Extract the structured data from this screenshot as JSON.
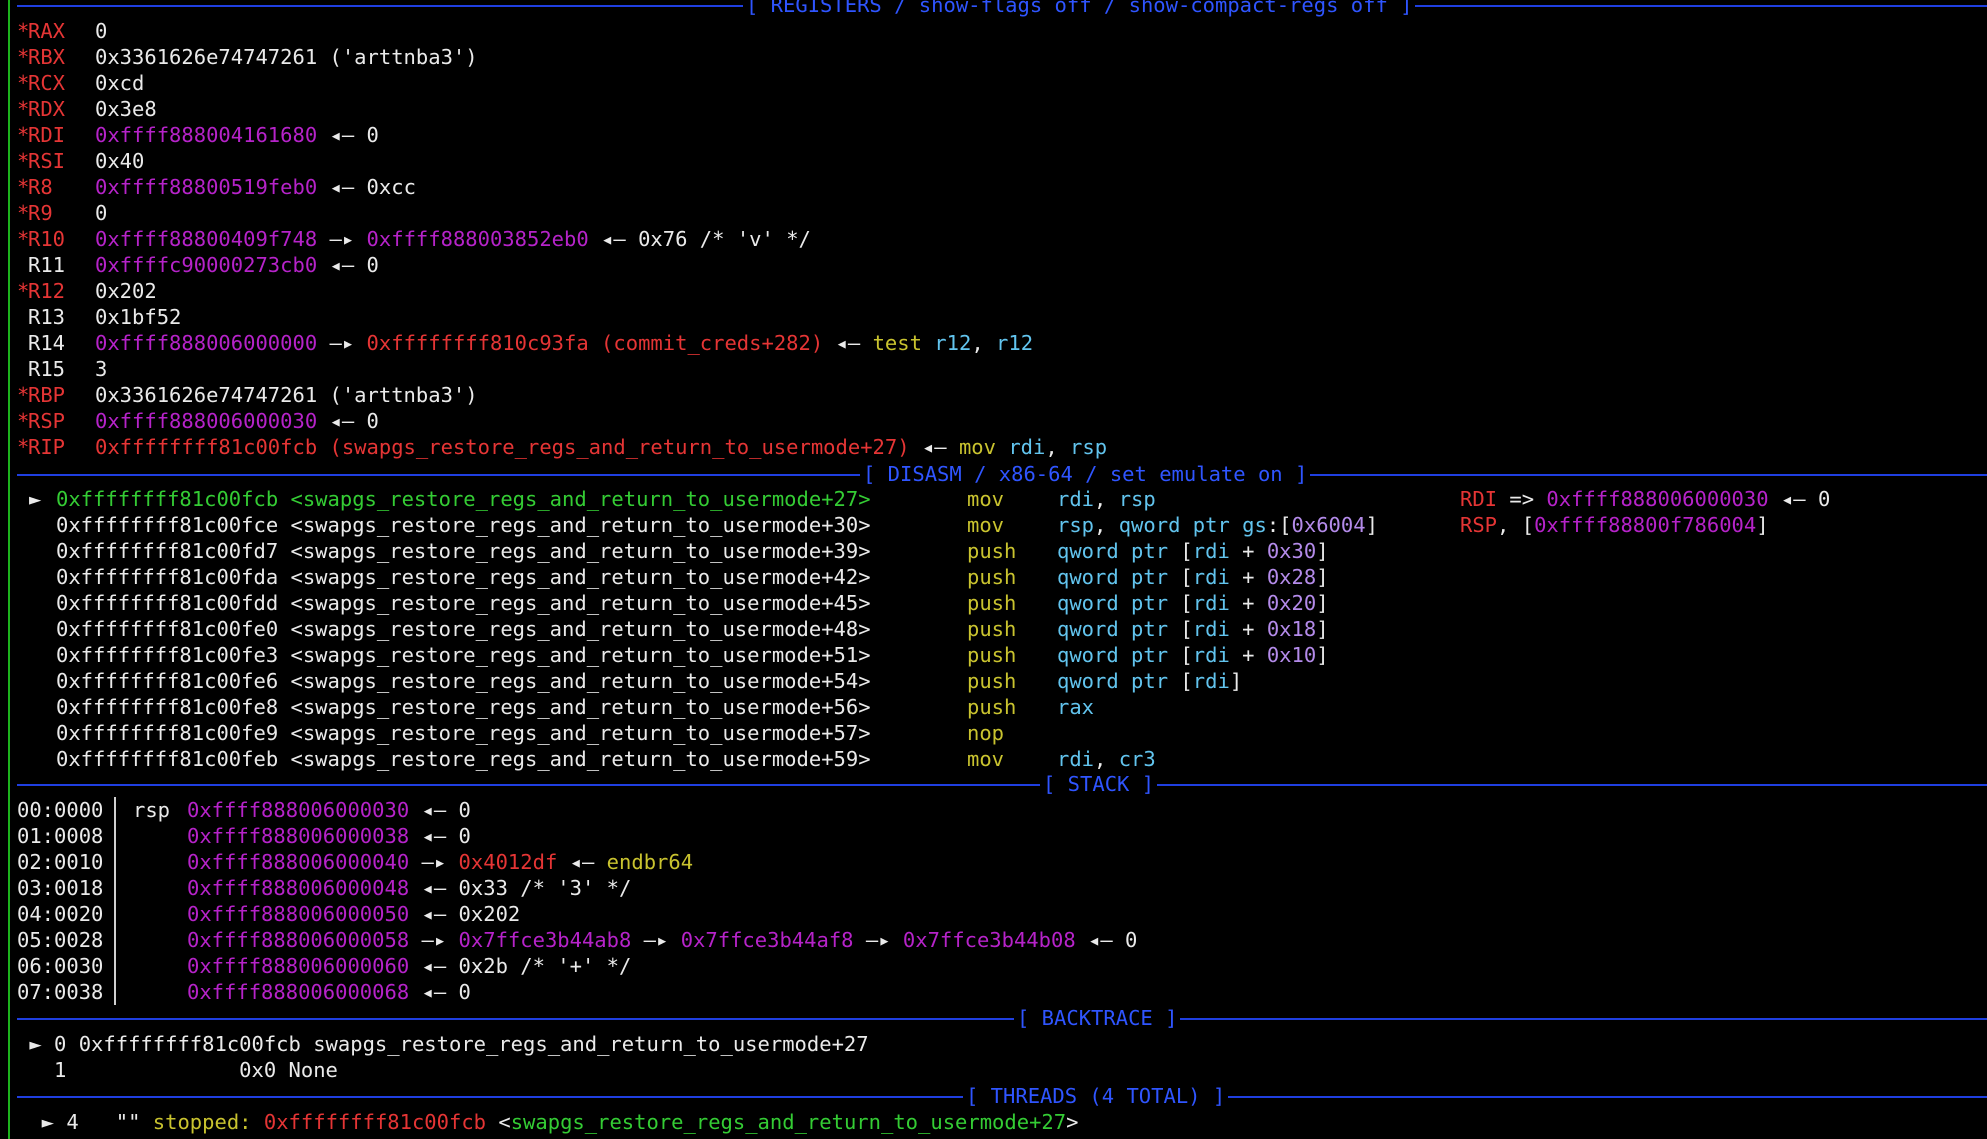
{
  "headers": {
    "registers": "[ REGISTERS / show-flags off / show-compact-regs off ]",
    "disasm": "[ DISASM / x86-64 / set emulate on ]",
    "stack": "[ STACK ]",
    "backtrace": "[ BACKTRACE ]",
    "threads": "[ THREADS (4 TOTAL) ]"
  },
  "registers": [
    {
      "mark": "*",
      "name": "RAX",
      "parts": [
        {
          "t": "0",
          "c": "wht"
        }
      ]
    },
    {
      "mark": "*",
      "name": "RBX",
      "parts": [
        {
          "t": "0x3361626e74747261 ('arttnba3')",
          "c": "wht"
        }
      ]
    },
    {
      "mark": "*",
      "name": "RCX",
      "parts": [
        {
          "t": "0xcd",
          "c": "wht"
        }
      ]
    },
    {
      "mark": "*",
      "name": "RDX",
      "parts": [
        {
          "t": "0x3e8",
          "c": "wht"
        }
      ]
    },
    {
      "mark": "*",
      "name": "RDI",
      "parts": [
        {
          "t": "0xffff888004161680",
          "c": "mag"
        },
        {
          "t": " ◂— 0",
          "c": "wht"
        }
      ]
    },
    {
      "mark": "*",
      "name": "RSI",
      "parts": [
        {
          "t": "0x40",
          "c": "wht"
        }
      ]
    },
    {
      "mark": "*",
      "name": "R8",
      "parts": [
        {
          "t": "0xffff88800519feb0",
          "c": "mag"
        },
        {
          "t": " ◂— 0xcc",
          "c": "wht"
        }
      ]
    },
    {
      "mark": "*",
      "name": "R9",
      "parts": [
        {
          "t": "0",
          "c": "wht"
        }
      ]
    },
    {
      "mark": "*",
      "name": "R10",
      "parts": [
        {
          "t": "0xffff88800409f748",
          "c": "mag"
        },
        {
          "t": " —▸ ",
          "c": "wht"
        },
        {
          "t": "0xffff888003852eb0",
          "c": "mag"
        },
        {
          "t": " ◂— 0x76 /* 'v' */",
          "c": "wht"
        }
      ]
    },
    {
      "mark": " ",
      "name": "R11",
      "parts": [
        {
          "t": "0xffffc90000273cb0",
          "c": "mag"
        },
        {
          "t": " ◂— 0",
          "c": "wht"
        }
      ]
    },
    {
      "mark": "*",
      "name": "R12",
      "parts": [
        {
          "t": "0x202",
          "c": "wht"
        }
      ]
    },
    {
      "mark": " ",
      "name": "R13",
      "parts": [
        {
          "t": "0x1bf52",
          "c": "wht"
        }
      ]
    },
    {
      "mark": " ",
      "name": "R14",
      "parts": [
        {
          "t": "0xffff888006000000",
          "c": "mag"
        },
        {
          "t": " —▸ ",
          "c": "wht"
        },
        {
          "t": "0xffffffff810c93fa (commit_creds+282)",
          "c": "red"
        },
        {
          "t": " ◂— ",
          "c": "wht"
        },
        {
          "t": "test",
          "c": "yel"
        },
        {
          "t": " ",
          "c": "wht"
        },
        {
          "t": "r12",
          "c": "cyan"
        },
        {
          "t": ", ",
          "c": "wht"
        },
        {
          "t": "r12",
          "c": "cyan"
        }
      ]
    },
    {
      "mark": " ",
      "name": "R15",
      "parts": [
        {
          "t": "3",
          "c": "wht"
        }
      ]
    },
    {
      "mark": "*",
      "name": "RBP",
      "parts": [
        {
          "t": "0x3361626e74747261 ('arttnba3')",
          "c": "wht"
        }
      ]
    },
    {
      "mark": "*",
      "name": "RSP",
      "parts": [
        {
          "t": "0xffff888006000030",
          "c": "mag"
        },
        {
          "t": " ◂— 0",
          "c": "wht"
        }
      ]
    },
    {
      "mark": "*",
      "name": "RIP",
      "parts": [
        {
          "t": "0xffffffff81c00fcb (swapgs_restore_regs_and_return_to_usermode+27)",
          "c": "red"
        },
        {
          "t": " ◂— ",
          "c": "wht"
        },
        {
          "t": "mov",
          "c": "yel"
        },
        {
          "t": " ",
          "c": "wht"
        },
        {
          "t": "rdi",
          "c": "cyan"
        },
        {
          "t": ", ",
          "c": "wht"
        },
        {
          "t": "rsp",
          "c": "cyan"
        }
      ]
    }
  ],
  "disasm": [
    {
      "cur": true,
      "addr": "0xffffffff81c00fcb <swapgs_restore_regs_and_return_to_usermode+27>",
      "mn": "mov",
      "ops": [
        {
          "t": "rdi",
          "c": "cyan"
        },
        {
          "t": ", ",
          "c": "wht"
        },
        {
          "t": "rsp",
          "c": "cyan"
        }
      ],
      "note": [
        {
          "t": "RDI",
          "c": "red"
        },
        {
          "t": " => ",
          "c": "wht"
        },
        {
          "t": "0xffff888006000030",
          "c": "mag"
        },
        {
          "t": " ◂— 0",
          "c": "wht"
        }
      ]
    },
    {
      "cur": false,
      "addr": "0xffffffff81c00fce <swapgs_restore_regs_and_return_to_usermode+30>",
      "mn": "mov",
      "ops": [
        {
          "t": "rsp",
          "c": "cyan"
        },
        {
          "t": ", ",
          "c": "wht"
        },
        {
          "t": "qword ptr",
          "c": "cyan"
        },
        {
          "t": " ",
          "c": "wht"
        },
        {
          "t": "gs",
          "c": "cyan"
        },
        {
          "t": ":[",
          "c": "wht"
        },
        {
          "t": "0x6004",
          "c": "pur"
        },
        {
          "t": "]",
          "c": "wht"
        }
      ],
      "note": [
        {
          "t": "RSP",
          "c": "red"
        },
        {
          "t": ", [",
          "c": "wht"
        },
        {
          "t": "0xffff88800f786004",
          "c": "mag"
        },
        {
          "t": "]",
          "c": "wht"
        }
      ]
    },
    {
      "cur": false,
      "addr": "0xffffffff81c00fd7 <swapgs_restore_regs_and_return_to_usermode+39>",
      "mn": "push",
      "ops": [
        {
          "t": "qword ptr",
          "c": "cyan"
        },
        {
          "t": " [",
          "c": "wht"
        },
        {
          "t": "rdi",
          "c": "cyan"
        },
        {
          "t": " + ",
          "c": "wht"
        },
        {
          "t": "0x30",
          "c": "pur"
        },
        {
          "t": "]",
          "c": "wht"
        }
      ],
      "note": []
    },
    {
      "cur": false,
      "addr": "0xffffffff81c00fda <swapgs_restore_regs_and_return_to_usermode+42>",
      "mn": "push",
      "ops": [
        {
          "t": "qword ptr",
          "c": "cyan"
        },
        {
          "t": " [",
          "c": "wht"
        },
        {
          "t": "rdi",
          "c": "cyan"
        },
        {
          "t": " + ",
          "c": "wht"
        },
        {
          "t": "0x28",
          "c": "pur"
        },
        {
          "t": "]",
          "c": "wht"
        }
      ],
      "note": []
    },
    {
      "cur": false,
      "addr": "0xffffffff81c00fdd <swapgs_restore_regs_and_return_to_usermode+45>",
      "mn": "push",
      "ops": [
        {
          "t": "qword ptr",
          "c": "cyan"
        },
        {
          "t": " [",
          "c": "wht"
        },
        {
          "t": "rdi",
          "c": "cyan"
        },
        {
          "t": " + ",
          "c": "wht"
        },
        {
          "t": "0x20",
          "c": "pur"
        },
        {
          "t": "]",
          "c": "wht"
        }
      ],
      "note": []
    },
    {
      "cur": false,
      "addr": "0xffffffff81c00fe0 <swapgs_restore_regs_and_return_to_usermode+48>",
      "mn": "push",
      "ops": [
        {
          "t": "qword ptr",
          "c": "cyan"
        },
        {
          "t": " [",
          "c": "wht"
        },
        {
          "t": "rdi",
          "c": "cyan"
        },
        {
          "t": " + ",
          "c": "wht"
        },
        {
          "t": "0x18",
          "c": "pur"
        },
        {
          "t": "]",
          "c": "wht"
        }
      ],
      "note": []
    },
    {
      "cur": false,
      "addr": "0xffffffff81c00fe3 <swapgs_restore_regs_and_return_to_usermode+51>",
      "mn": "push",
      "ops": [
        {
          "t": "qword ptr",
          "c": "cyan"
        },
        {
          "t": " [",
          "c": "wht"
        },
        {
          "t": "rdi",
          "c": "cyan"
        },
        {
          "t": " + ",
          "c": "wht"
        },
        {
          "t": "0x10",
          "c": "pur"
        },
        {
          "t": "]",
          "c": "wht"
        }
      ],
      "note": []
    },
    {
      "cur": false,
      "addr": "0xffffffff81c00fe6 <swapgs_restore_regs_and_return_to_usermode+54>",
      "mn": "push",
      "ops": [
        {
          "t": "qword ptr",
          "c": "cyan"
        },
        {
          "t": " [",
          "c": "wht"
        },
        {
          "t": "rdi",
          "c": "cyan"
        },
        {
          "t": "]",
          "c": "wht"
        }
      ],
      "note": []
    },
    {
      "cur": false,
      "addr": "0xffffffff81c00fe8 <swapgs_restore_regs_and_return_to_usermode+56>",
      "mn": "push",
      "ops": [
        {
          "t": "rax",
          "c": "cyan"
        }
      ],
      "note": []
    },
    {
      "cur": false,
      "addr": "0xffffffff81c00fe9 <swapgs_restore_regs_and_return_to_usermode+57>",
      "mn": "nop",
      "ops": [],
      "note": []
    },
    {
      "cur": false,
      "addr": "0xffffffff81c00feb <swapgs_restore_regs_and_return_to_usermode+59>",
      "mn": "mov",
      "ops": [
        {
          "t": "rdi",
          "c": "cyan"
        },
        {
          "t": ", ",
          "c": "wht"
        },
        {
          "t": "cr3",
          "c": "cyan"
        }
      ],
      "note": []
    }
  ],
  "stack": [
    {
      "idx": "00:0000",
      "reg": "rsp",
      "parts": [
        {
          "t": "0xffff888006000030",
          "c": "mag"
        },
        {
          "t": " ◂— 0",
          "c": "wht"
        }
      ]
    },
    {
      "idx": "01:0008",
      "reg": "",
      "parts": [
        {
          "t": "0xffff888006000038",
          "c": "mag"
        },
        {
          "t": " ◂— 0",
          "c": "wht"
        }
      ]
    },
    {
      "idx": "02:0010",
      "reg": "",
      "parts": [
        {
          "t": "0xffff888006000040",
          "c": "mag"
        },
        {
          "t": " —▸ ",
          "c": "wht"
        },
        {
          "t": "0x4012df",
          "c": "red"
        },
        {
          "t": " ◂— ",
          "c": "wht"
        },
        {
          "t": "endbr64",
          "c": "yel"
        }
      ]
    },
    {
      "idx": "03:0018",
      "reg": "",
      "parts": [
        {
          "t": "0xffff888006000048",
          "c": "mag"
        },
        {
          "t": " ◂— 0x33 /* '3' */",
          "c": "wht"
        }
      ]
    },
    {
      "idx": "04:0020",
      "reg": "",
      "parts": [
        {
          "t": "0xffff888006000050",
          "c": "mag"
        },
        {
          "t": " ◂— 0x202",
          "c": "wht"
        }
      ]
    },
    {
      "idx": "05:0028",
      "reg": "",
      "parts": [
        {
          "t": "0xffff888006000058",
          "c": "mag"
        },
        {
          "t": " —▸ ",
          "c": "wht"
        },
        {
          "t": "0x7ffce3b44ab8",
          "c": "mag"
        },
        {
          "t": " —▸ ",
          "c": "wht"
        },
        {
          "t": "0x7ffce3b44af8",
          "c": "mag"
        },
        {
          "t": " —▸ ",
          "c": "wht"
        },
        {
          "t": "0x7ffce3b44b08",
          "c": "mag"
        },
        {
          "t": " ◂— 0",
          "c": "wht"
        }
      ]
    },
    {
      "idx": "06:0030",
      "reg": "",
      "parts": [
        {
          "t": "0xffff888006000060",
          "c": "mag"
        },
        {
          "t": " ◂— 0x2b /* '+' */",
          "c": "wht"
        }
      ]
    },
    {
      "idx": "07:0038",
      "reg": "",
      "parts": [
        {
          "t": "0xffff888006000068",
          "c": "mag"
        },
        {
          "t": " ◂— 0",
          "c": "wht"
        }
      ]
    }
  ],
  "backtrace": [
    {
      "text": " ► 0 0xffffffff81c00fcb swapgs_restore_regs_and_return_to_usermode+27"
    },
    {
      "text": "   1              0x0 None"
    }
  ],
  "threads": {
    "arrow": "  ► 4   \"\" ",
    "state": "stopped:",
    "addr": "0xffffffff81c00fcb",
    "sym_open": " <",
    "sym": "swapgs_restore_regs_and_return_to_usermode+27",
    "sym_close": ">"
  },
  "colors": {
    "red": "#e53535",
    "magenta": "#b623c9",
    "green": "#34cc34",
    "yellow": "#c9c32f",
    "cyan": "#62c4ee",
    "purple": "#b48bea",
    "blue": "#2f55ff"
  }
}
